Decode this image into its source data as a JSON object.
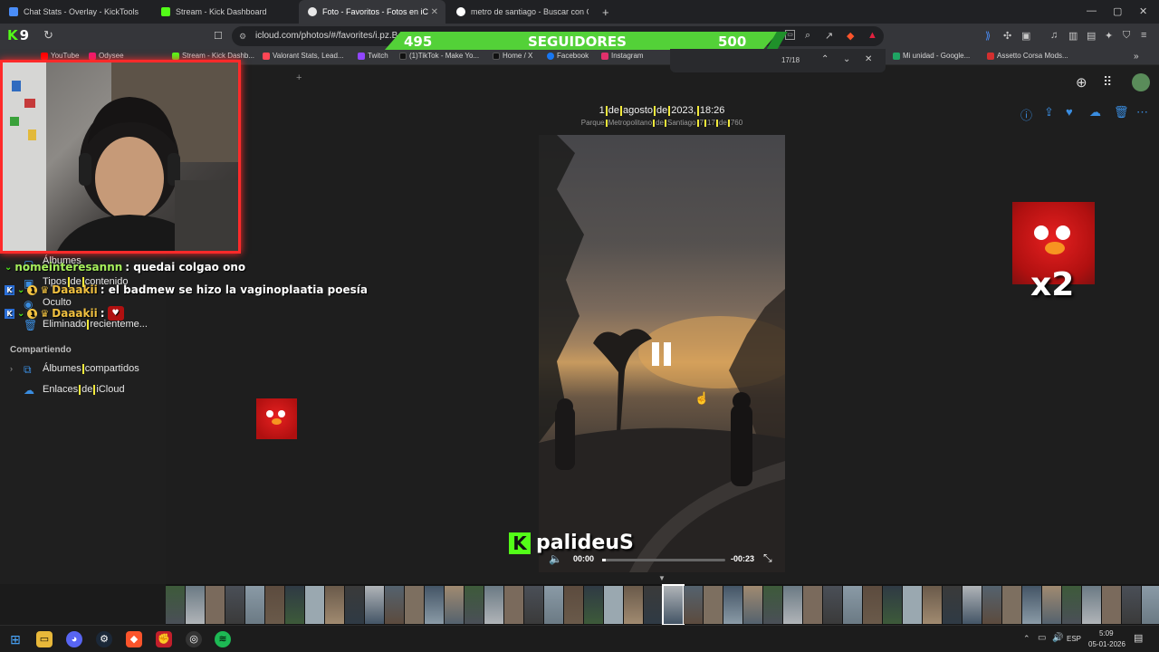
{
  "tabs": [
    {
      "title": "Chat Stats - Overlay - KickTools",
      "color": "#4a8df8"
    },
    {
      "title": "Stream - Kick Dashboard",
      "color": "#53fc18"
    },
    {
      "title": "Foto - Favoritos - Fotos en iC",
      "color": "#e8e8e8",
      "active": true
    },
    {
      "title": "metro de santiago - Buscar con Goog",
      "color": "#ffffff"
    }
  ],
  "new_tab": "+",
  "window_controls": {
    "min": "—",
    "max": "▢",
    "close": "✕"
  },
  "address": {
    "url": "icloud.com/photos/#/favorites/i.pz.B"
  },
  "kick_logo": {
    "letter": "K",
    "count": "9"
  },
  "bookmarks": [
    {
      "label": "YouTube",
      "color": "#ff0000"
    },
    {
      "label": "Odysee",
      "color": "#ef1970"
    },
    {
      "label": "Stream - Kick Dashb...",
      "color": "#53fc18"
    },
    {
      "label": "Valorant Stats, Lead...",
      "color": "#ff4655"
    },
    {
      "label": "Twitch",
      "color": "#9146ff"
    },
    {
      "label": "(1)TikTok - Make Yo...",
      "color": "#111111"
    },
    {
      "label": "Home / X",
      "color": "#111111"
    },
    {
      "label": "Facebook",
      "color": "#1877f2"
    },
    {
      "label": "Instagram",
      "color": "#e1306c"
    },
    {
      "label": "Mi unidad - Google...",
      "color": "#1fa463"
    },
    {
      "label": "Assetto Corsa Mods...",
      "color": "#d32f2f"
    }
  ],
  "findbar": {
    "count": "17/18"
  },
  "followers_overlay": {
    "current": "495",
    "label": "SEGUIDORES",
    "goal": "500",
    "progress": 0.99
  },
  "photo": {
    "date": [
      "1",
      "de",
      "agosto",
      "de",
      "2023,",
      "18:26"
    ],
    "location": [
      "Parque",
      "Metropolitano",
      "de",
      "Santiago",
      "7",
      "17",
      "de",
      "760"
    ]
  },
  "video": {
    "elapsed": "00:00",
    "remaining": "-00:23"
  },
  "sidebar": {
    "items": [
      {
        "label": "Álbumes"
      },
      {
        "label": [
          "Tipos",
          "de",
          "contenido"
        ]
      },
      {
        "label": "Oculto"
      },
      {
        "label": [
          "Eliminado",
          "recienteme..."
        ]
      }
    ],
    "section": "Compartiendo",
    "shared": [
      {
        "label": [
          "Álbumes",
          "compartidos"
        ]
      },
      {
        "label": [
          "Enlaces",
          "de",
          "iCloud"
        ]
      }
    ]
  },
  "chat": [
    {
      "user": "nomeinteresannn",
      "user_color": "#a6ef5b",
      "msg": ": quedai colgao ono"
    },
    {
      "user": "Daaakii",
      "user_color": "#f0c040",
      "badge": "1",
      "msg": ": el badmew se hizo la vaginoplaatia poesía"
    },
    {
      "user": "Daaakii",
      "user_color": "#f0c040",
      "badge": "1",
      "msg": ":"
    }
  ],
  "elmo_multiplier": "x2",
  "kick_name": "palideuS",
  "taskbar": {
    "lang": "ESP",
    "time": "5:09",
    "date": "05-01-2026"
  },
  "colors": {
    "accent": "#53fc18",
    "icloud_blue": "#3a8de0",
    "highlight": "#f3ea3b"
  }
}
